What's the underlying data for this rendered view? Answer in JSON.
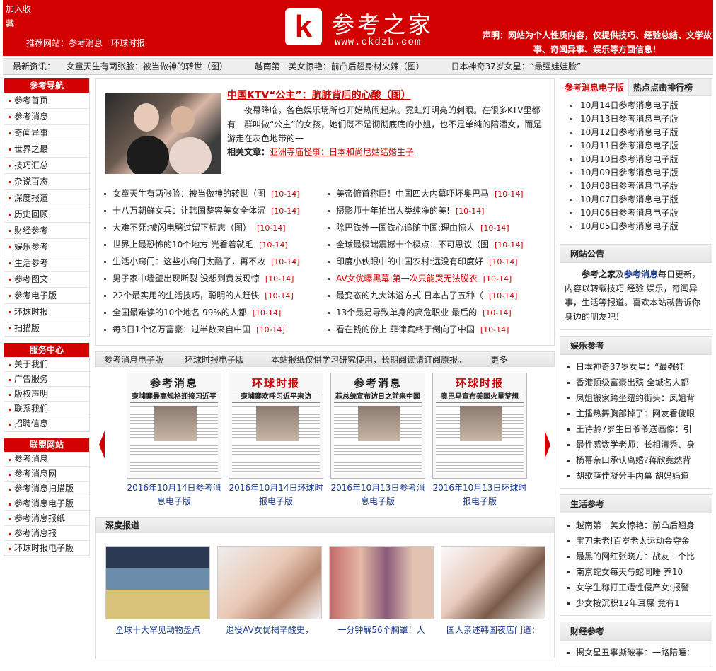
{
  "header": {
    "favorite": [
      "加入收",
      "藏"
    ],
    "recommend_label": "推荐网站：",
    "recommend_links": [
      "参考消息",
      "环球时报"
    ],
    "logo_letter": "k",
    "logo_name": "参考之家",
    "logo_url": "www.ckdzb.com",
    "declaration": "声明：网站为个人性质内容，仅提供技巧、经验总结、文学故事、奇闻异事、娱乐等方面信息！"
  },
  "ticker": {
    "label": "最新资讯：",
    "items": [
      "女童天生有两张脸：被当做神的转世（图）",
      "越南第一美女惊艳：前凸后翘身材火辣（图）",
      "日本神奇37岁女星：“最强娃娃脸”"
    ]
  },
  "left": {
    "nav_title": "参考导航",
    "nav": [
      "参考首页",
      "参考消息",
      "奇闻异事",
      "世界之最",
      "技巧汇总",
      "杂说百态",
      "深度报道",
      "历史回顾",
      "财经参考",
      "娱乐参考",
      "生活参考",
      "参考图文",
      "参考电子版",
      "环球时报",
      "扫描版"
    ],
    "service_title": "服务中心",
    "service": [
      "关于我们",
      "广告服务",
      "版权声明",
      "联系我们",
      "招聘信息"
    ],
    "union_title": "联盟网站",
    "union": [
      "参考消息",
      "参考消息网",
      "参考消息扫描版",
      "参考消息电子版",
      "参考消息报纸",
      "参考消息报",
      "环球时报电子版"
    ]
  },
  "featured": {
    "title": "中国KTV“公主”：肮脏背后的心酸（图）",
    "desc": "夜幕降临，各色娱乐场所也开始热闹起来。霓虹灯明亮的刺眼。在很多KTV里都有一群叫做“公主”的女孩，她们既不是彻彻底底的小姐，也不是单纯的陪酒女，而是游走在灰色地带的一",
    "related_label": "相关文章：",
    "related_link": "亚洲寺庙怪事：日本和尚尼姑结婚生子"
  },
  "news_left": [
    {
      "t": "女童天生有两张脸：被当做神的转世（图",
      "d": "[10-14]"
    },
    {
      "t": "十八万朝鲜女兵：让韩国整容美女全体沉",
      "d": "[10-14]"
    },
    {
      "t": "大难不死:被闪电劈过留下标志（图）",
      "d": "[10-14]"
    },
    {
      "t": "世界上最恐怖的10个地方 光看着就毛",
      "d": "[10-14]"
    },
    {
      "t": "生活小窍门：这些小窍门太酷了，再不收",
      "d": "[10-14]"
    },
    {
      "t": "男子家中墙壁出现断裂 没想到竟发现惊",
      "d": "[10-14]"
    },
    {
      "t": "22个最实用的生活技巧，聪明的人赶快",
      "d": "[10-14]"
    },
    {
      "t": "全国最难读的10个地名 99%的人都",
      "d": "[10-14]"
    },
    {
      "t": "每3日1个亿万富豪：过半数来自中国",
      "d": "[10-14]"
    }
  ],
  "news_right": [
    {
      "t": "美帝俯首称臣！中国四大内幕吓坏奥巴马",
      "d": "[10-14]",
      "red": false
    },
    {
      "t": "摄影师十年拍出人类纯净的美!",
      "d": "[10-14]",
      "red": false
    },
    {
      "t": "除巴铁外一国铁心追随中国:理由惊人",
      "d": "[10-14]",
      "red": false
    },
    {
      "t": "全球最极端震撼十个极点：不可思议（图",
      "d": "[10-14]",
      "red": false
    },
    {
      "t": "印度小伙眼中的中国农村:远没有印度好",
      "d": "[10-14]",
      "red": false
    },
    {
      "t": "AV女优曝黑幕:第一次只能哭无法脱衣",
      "d": "[10-14]",
      "red": true
    },
    {
      "t": "最变态的九大沐浴方式 日本占了五种（",
      "d": "[10-14]",
      "red": false
    },
    {
      "t": "13个最易导致单身的高危职业 最后的",
      "d": "[10-14]",
      "red": false
    },
    {
      "t": "看在钱的份上 菲律宾终于倒向了中国",
      "d": "[10-14]",
      "red": false
    }
  ],
  "papers": {
    "tabs": [
      "参考消息电子版",
      "环球时报电子版"
    ],
    "notice": "本站报纸仅供学习研究使用，长期阅读请订阅原报。",
    "more": "更多",
    "items": [
      {
        "mast": "参考消息",
        "hl": "柬埔寨最高规格迎接习近平",
        "cap": "2016年10月14日参考消息电子版",
        "red": false
      },
      {
        "mast": "环球时报",
        "hl": "柬埔寨欢呼习近平来访",
        "cap": "2016年10月14日环球时报电子版",
        "red": true
      },
      {
        "mast": "参考消息",
        "hl": "菲总统宣布访日之前来中国",
        "cap": "2016年10月13日参考消息电子版",
        "red": false
      },
      {
        "mast": "环球时报",
        "hl": "奥巴马宣布美国火星梦想",
        "cap": "2016年10月13日环球时报电子版",
        "red": true
      }
    ]
  },
  "deep": {
    "title": "深度报道",
    "items": [
      "全球十大罕见动物盘点",
      "退役AV女优揭辛酸史，",
      "一分钟解56个胸罩！人",
      "国人亲述韩国夜店门道："
    ]
  },
  "right": {
    "tabs": [
      "参考消息电子版",
      "热点点击排行榜"
    ],
    "editions": [
      "10月14日参考消息电子版",
      "10月13日参考消息电子版",
      "10月12日参考消息电子版",
      "10月11日参考消息电子版",
      "10月10日参考消息电子版",
      "10月09日参考消息电子版",
      "10月08日参考消息电子版",
      "10月07日参考消息电子版",
      "10月06日参考消息电子版",
      "10月05日参考消息电子版"
    ],
    "notice_title": "网站公告",
    "notice_site": "参考之家",
    "notice_and": "及",
    "notice_paper": "参考消息",
    "notice_body": "每日更新，内容以转载技巧 经验 娱乐，奇闻异事，生活等报道。喜欢本站就告诉你身边的朋友吧！",
    "ent_title": "娱乐参考",
    "ent": [
      "日本神奇37岁女星：“最强娃",
      "香港顶级富豪出殡 全城名人都",
      "凤姐搬家跨坐纽约街头：凤姐背",
      "主播热舞胸部掉了：网友看傻眼",
      "王诗龄7岁生日爷爷送画像：引",
      "最性感数学老师：长相清秀、身",
      "杨幂亲口承认离婚?蒋欣竟然背",
      "胡歌薛佳凝分手内幕 胡妈妈道"
    ],
    "life_title": "生活参考",
    "life": [
      "越南第一美女惊艳：前凸后翘身",
      "宝刀未老!百岁老太运动会夺金",
      "最黑的网红张晓方：战友一个比",
      "南京蛇女每天与蛇同睡 养10",
      "女学生称打工遭性侵产女:报警",
      "少女按沉积12年耳屎 竟有1"
    ],
    "fin_title": "财经参考",
    "fin": [
      "揭女星丑事撕破事：一路陪睡："
    ]
  }
}
